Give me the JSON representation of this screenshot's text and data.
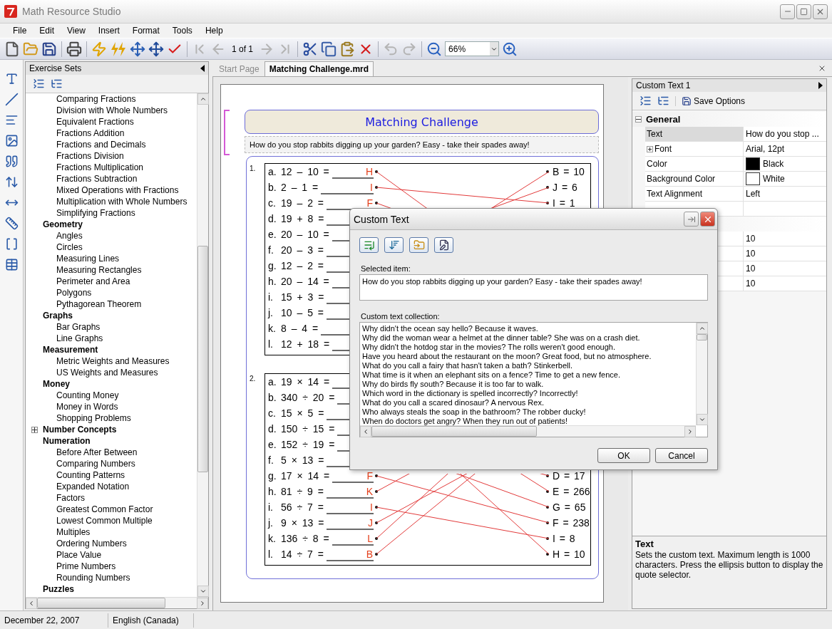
{
  "window": {
    "title": "Math Resource Studio"
  },
  "menu": [
    "File",
    "Edit",
    "View",
    "Insert",
    "Format",
    "Tools",
    "Help"
  ],
  "toolbar": [
    {
      "kind": "new",
      "disabled": false
    },
    {
      "kind": "open",
      "disabled": false
    },
    {
      "kind": "save",
      "disabled": false
    },
    {
      "kind": "separator"
    },
    {
      "kind": "print",
      "disabled": false
    },
    {
      "kind": "separator"
    },
    {
      "kind": "lightning",
      "disabled": false
    },
    {
      "kind": "double_lightning",
      "disabled": false
    },
    {
      "kind": "arrange",
      "disabled": false
    },
    {
      "kind": "arrange_all",
      "disabled": false
    },
    {
      "kind": "check",
      "disabled": false
    },
    {
      "kind": "separator"
    },
    {
      "kind": "first",
      "disabled": true
    },
    {
      "kind": "previous",
      "disabled": true
    },
    {
      "kind": "page",
      "text": "1 of 1"
    },
    {
      "kind": "next",
      "disabled": true
    },
    {
      "kind": "last",
      "disabled": true
    },
    {
      "kind": "separator"
    },
    {
      "kind": "cut",
      "disabled": false
    },
    {
      "kind": "copy",
      "disabled": false
    },
    {
      "kind": "paste",
      "disabled": false
    },
    {
      "kind": "delete",
      "disabled": false
    },
    {
      "kind": "separator"
    },
    {
      "kind": "undo",
      "disabled": true
    },
    {
      "kind": "redo",
      "disabled": true
    },
    {
      "kind": "separator"
    },
    {
      "kind": "zoom_out",
      "disabled": false
    },
    {
      "kind": "zoom",
      "value": "66%"
    },
    {
      "kind": "zoom_in",
      "disabled": false
    }
  ],
  "exercise_sets": {
    "title": "Exercise Sets",
    "tree": [
      {
        "children": [
          {
            "label": "Comparing Fractions"
          },
          {
            "label": "Division with Whole Numbers"
          },
          {
            "label": "Equivalent Fractions"
          },
          {
            "label": "Fractions Addition"
          },
          {
            "label": "Fractions and Decimals"
          },
          {
            "label": "Fractions Division"
          },
          {
            "label": "Fractions Multiplication"
          },
          {
            "label": "Fractions Subtraction"
          },
          {
            "label": "Mixed Operations with Fractions"
          },
          {
            "label": "Multiplication with Whole Numbers"
          },
          {
            "label": "Simplifying Fractions"
          }
        ]
      },
      {
        "label": "Geometry",
        "expanded": true,
        "children": [
          {
            "label": "Angles"
          },
          {
            "label": "Circles"
          },
          {
            "label": "Measuring Lines"
          },
          {
            "label": "Measuring Rectangles"
          },
          {
            "label": "Perimeter and Area"
          },
          {
            "label": "Polygons"
          },
          {
            "label": "Pythagorean Theorem"
          }
        ]
      },
      {
        "label": "Graphs",
        "expanded": true,
        "children": [
          {
            "label": "Bar Graphs"
          },
          {
            "label": "Line Graphs"
          }
        ]
      },
      {
        "label": "Measurement",
        "expanded": true,
        "children": [
          {
            "label": "Metric Weights and Measures"
          },
          {
            "label": "US Weights and Measures"
          }
        ]
      },
      {
        "label": "Money",
        "expanded": true,
        "children": [
          {
            "label": "Counting Money"
          },
          {
            "label": "Money in Words"
          },
          {
            "label": "Shopping Problems"
          }
        ]
      },
      {
        "label": "Number Concepts",
        "expanded": false
      },
      {
        "label": "Numeration",
        "expanded": true,
        "children": [
          {
            "label": "Before After Between"
          },
          {
            "label": "Comparing Numbers"
          },
          {
            "label": "Counting Patterns"
          },
          {
            "label": "Expanded Notation"
          },
          {
            "label": "Factors"
          },
          {
            "label": "Greatest Common Factor"
          },
          {
            "label": "Lowest Common Multiple"
          },
          {
            "label": "Multiples"
          },
          {
            "label": "Ordering Numbers"
          },
          {
            "label": "Place Value"
          },
          {
            "label": "Prime Numbers"
          },
          {
            "label": "Rounding Numbers"
          }
        ]
      },
      {
        "label": "Puzzles",
        "expanded": true
      }
    ]
  },
  "tabs": [
    {
      "label": "Start Page",
      "selected": false
    },
    {
      "label": "Matching Challenge.mrd",
      "selected": true
    }
  ],
  "worksheet": {
    "title": "Matching Challenge",
    "subtitle": "How do you stop rabbits digging up your garden? Easy - take their spades away!",
    "problems": [
      {
        "number": "1.",
        "rows": [
          {
            "label": "a.",
            "expr": "12 – 10 =",
            "answer": "H",
            "match": "B = 10"
          },
          {
            "label": "b.",
            "expr": "2 – 1 =",
            "answer": "I",
            "match": "J = 6"
          },
          {
            "label": "c.",
            "expr": "19 – 2 =",
            "answer": "F",
            "match": "I = 1"
          },
          {
            "label": "d.",
            "expr": "19 + 8 ="
          },
          {
            "label": "e.",
            "expr": "20 – 10 ="
          },
          {
            "label": "f.",
            "expr": "20 – 3 ="
          },
          {
            "label": "g.",
            "expr": "12 – 2 ="
          },
          {
            "label": "h.",
            "expr": "20 – 14 ="
          },
          {
            "label": "i.",
            "expr": "15 + 3 ="
          },
          {
            "label": "j.",
            "expr": "10 – 5 ="
          },
          {
            "label": "k.",
            "expr": "8 – 4 ="
          },
          {
            "label": "l.",
            "expr": "12 + 18 ="
          }
        ]
      },
      {
        "number": "2.",
        "rows": [
          {
            "label": "a.",
            "expr": "19 × 14 ="
          },
          {
            "label": "b.",
            "expr": "340 ÷ 20 ="
          },
          {
            "label": "c.",
            "expr": "15 × 5 ="
          },
          {
            "label": "d.",
            "expr": "150 ÷ 15 ="
          },
          {
            "label": "e.",
            "expr": "152 ÷ 19 ="
          },
          {
            "label": "f.",
            "expr": "5 × 13 ="
          },
          {
            "label": "g.",
            "expr": "17 × 14 =",
            "answer": "F",
            "match": "D = 17"
          },
          {
            "label": "h.",
            "expr": "81 ÷ 9 =",
            "answer": "K",
            "match": "E = 266"
          },
          {
            "label": "i.",
            "expr": "56 ÷ 7 =",
            "answer": "I",
            "match": "G = 65"
          },
          {
            "label": "j.",
            "expr": "9 × 13 =",
            "answer": "J",
            "match": "F = 238"
          },
          {
            "label": "k.",
            "expr": "136 ÷ 8 =",
            "answer": "L",
            "match": "I = 8"
          },
          {
            "label": "l.",
            "expr": "14 ÷ 7 =",
            "answer": "B",
            "match": "H = 10"
          }
        ]
      }
    ]
  },
  "properties": {
    "title": "Custom Text 1",
    "save_button": "Save Options",
    "rows": [
      {
        "kind": "category",
        "label": "General",
        "expanded": true
      },
      {
        "kind": "property",
        "label": "Text",
        "value": "How do you stop ...",
        "selected": true
      },
      {
        "kind": "property",
        "label": "Font",
        "value": "Arial, 12pt",
        "expanded": false,
        "selected": false
      },
      {
        "kind": "property",
        "label": "Color",
        "value": "Black",
        "color": "#000000",
        "selected": false
      },
      {
        "kind": "property",
        "label": "Background Color",
        "value": "White",
        "color": "#ffffff",
        "selected": false
      },
      {
        "kind": "property",
        "label": "Text Alignment",
        "value": "Left",
        "selected": false
      },
      {
        "kind": "empty"
      },
      {
        "kind": "category"
      },
      {
        "kind": "property",
        "value": "10",
        "selected": false
      },
      {
        "kind": "property",
        "value": "10",
        "selected": false
      },
      {
        "kind": "property",
        "value": "10",
        "selected": false
      },
      {
        "kind": "property",
        "value": "10",
        "selected": false
      }
    ],
    "description": {
      "title": "Text",
      "text": "Sets the custom text. Maximum length is 1000 characters. Press the ellipsis button to display the quote selector."
    }
  },
  "dialog": {
    "title": "Custom Text",
    "selected_label": "Selected item:",
    "selected_value": "How do you stop rabbits digging up your garden? Easy - take their spades away!",
    "collection_label": "Custom text collection:",
    "collection": [
      "Why didn't the ocean say hello?  Because it waves.",
      "Why did the woman wear a helmet at the dinner table? She was on a crash diet.",
      "Why didn't the hotdog star in the movies? The rolls weren't good enough.",
      "Have you heard about the restaurant on the moon? Great food, but no atmosphere.",
      "What do you call a fairy that hasn't taken a bath? Stinkerbell.",
      "What time is it when an elephant sits on a fence? Time to get a new fence.",
      "Why do birds fly south? Because it is too far to walk.",
      "Which word in the dictionary is spelled incorrectly? Incorrectly!",
      "What do you call a scared dinosaur? A nervous Rex.",
      "Who always steals the soap in the bathroom? The robber ducky!",
      "When do doctors get angry? When they run out of patients!"
    ],
    "buttons": [
      "OK",
      "Cancel"
    ]
  },
  "status_bar": [
    "December 22, 2007",
    "English (Canada)"
  ]
}
